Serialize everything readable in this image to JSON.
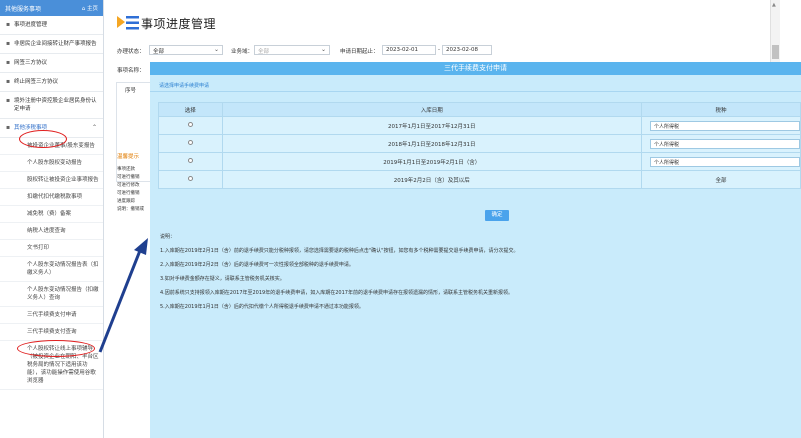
{
  "sidebar": {
    "header": "其他服务事项",
    "home": "主页",
    "items": [
      {
        "label": "事项进度管理"
      },
      {
        "label": "非居民企业间接转让财产事项报告"
      },
      {
        "label": "网签三方协议"
      },
      {
        "label": "终止网签三方协议"
      },
      {
        "label": "境外注册中资控股企业居民身份认定申请"
      },
      {
        "label": "其他涉税事项"
      }
    ],
    "subitems": [
      {
        "label": "被投资企业董事/股东变报告"
      },
      {
        "label": "个人股东股权变动报告"
      },
      {
        "label": "股权转让被投资企业事项报告"
      },
      {
        "label": "扣缴代扣代缴税款事项"
      },
      {
        "label": "减免税（费）备案"
      },
      {
        "label": "纳税人进度查询"
      },
      {
        "label": "文书打印"
      },
      {
        "label": "个人股东变动情况报告表（扣缴义务人）"
      },
      {
        "label": "个人股东变动情况报告（扣缴义务人）查询"
      },
      {
        "label": "三代手续费支付申请"
      },
      {
        "label": "三代手续费支付查询"
      },
      {
        "label": "个人股权转让线上事项辅导（被投资企业在朝阳、丰台区税务局的情况下适用该功能），该功能操作需使用谷歌浏览器"
      }
    ]
  },
  "page": {
    "title": "事项进度管理",
    "filters": {
      "status_label": "办理状态：",
      "status_value": "全部",
      "business_label": "业务域：",
      "business_value": "全部",
      "date_label": "申请日期起止：",
      "date_start": "2023-02-01",
      "date_sep": "-",
      "date_end": "2023-02-08",
      "name_label": "事项名称："
    },
    "bg_table_header": "序号",
    "bg_hint_title": "温馨提示",
    "bg_hint_lines": [
      "事项还款",
      "可进行撤销",
      "可进行修改",
      "可进行撤销",
      "进度跟踪",
      "说明：撤销或"
    ]
  },
  "dialog": {
    "title": "三代手续费支付申请",
    "tab": "请选择申请手续费申请",
    "columns": [
      "选择",
      "入库日期",
      "税种"
    ],
    "rows": [
      {
        "date": "2017年1月1日至2017年12月31日",
        "tax": "个人所得税"
      },
      {
        "date": "2018年1月1日至2018年12月31日",
        "tax": "个人所得税"
      },
      {
        "date": "2019年1月1日至2019年2月1日（含）",
        "tax": "个人所得税"
      },
      {
        "date": "2019年2月2日（含）及其以后",
        "tax": "全部"
      }
    ],
    "confirm": "确定",
    "notes_title": "说明：",
    "notes": [
      "1.入库期在2019年2月1日（含）前的退手续费只能分税种报领，请您选择需要退的税种后点击\"确认\"按钮，如您有多个税种需要提交退手续费申请，请分次提交。",
      "2.入库期在2019年2月2日（含）后的退手续费可一次性报领全部税种的退手续费申请。",
      "3.如对手续费金额存在疑义，请联系主管税务机关核实。",
      "4.因前系统只支持报领入库期在2017年至2019年的退手续费申请，如入库期在2017年前的退手续费申请存在报领遗漏的情形，请联系主管税务机关重新报领。",
      "5.入库期在2019年1月1日（含）后的代扣代缴个人所得税退手续费申请不通过本功能报领。"
    ]
  },
  "colors": {
    "sidebar_header": "#4a8fd9",
    "dialog_bg": "#c9ebfb",
    "dialog_title": "#5ab4ee",
    "annotation": "#e02020",
    "arrow": "#1f3f8f"
  }
}
